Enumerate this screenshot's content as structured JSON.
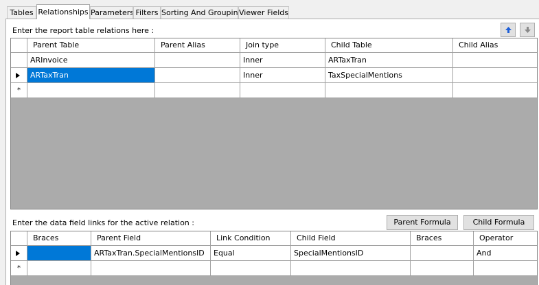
{
  "tabs": [
    {
      "label": "Tables"
    },
    {
      "label": "Relationships"
    },
    {
      "label": "Parameters"
    },
    {
      "label": "Filters"
    },
    {
      "label": "Sorting And Grouping"
    },
    {
      "label": "Viewer Fields"
    }
  ],
  "relations_section": {
    "label": "Enter the report table relations here :",
    "columns": [
      "Parent Table",
      "Parent Alias",
      "Join type",
      "Child Table",
      "Child Alias"
    ],
    "rows": [
      [
        "ARInvoice",
        "",
        "Inner",
        "ARTaxTran",
        ""
      ],
      [
        "ARTaxTran",
        "",
        "Inner",
        "TaxSpecialMentions",
        ""
      ]
    ],
    "new_row_marker": "*",
    "move_up_icon": "arrow-up-icon",
    "move_down_icon": "arrow-down-icon"
  },
  "links_section": {
    "label": "Enter the data field links for the active relation :",
    "parent_formula_label": "Parent Formula",
    "child_formula_label": "Child Formula",
    "columns": [
      "Braces",
      "Parent Field",
      "Link Condition",
      "Child Field",
      "Braces",
      "Operator"
    ],
    "rows": [
      [
        "",
        "ARTaxTran.SpecialMentionsID",
        "Equal",
        "SpecialMentionsID",
        "",
        "And"
      ]
    ],
    "new_row_marker": "*"
  },
  "colors": {
    "selection": "#0078d7",
    "grid_empty": "#ababab",
    "up_arrow": "#1e5fd8",
    "down_arrow": "#8a8a8a"
  }
}
